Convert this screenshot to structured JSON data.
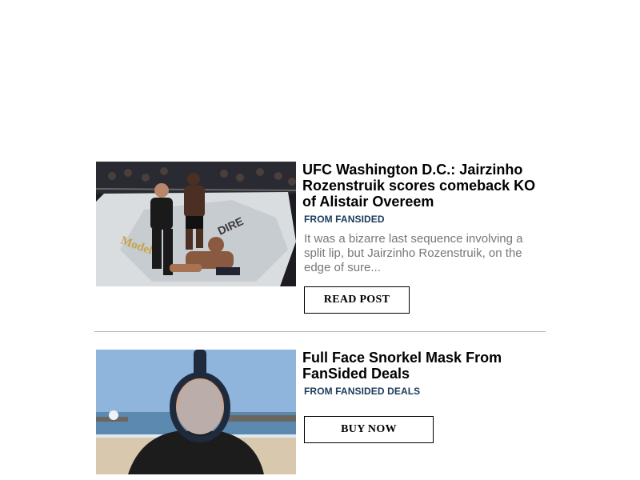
{
  "articles": [
    {
      "title": "UFC Washington D.C.: Jairzinho Rozenstruik scores comeback KO of Alistair Overeem",
      "source": "FROM FANSIDED",
      "excerpt": "It was a bizarre last sequence involving a split lip, but Jairzinho Rozenstruik, on the edge of sure...",
      "button_label": "READ POST",
      "image": {
        "octagon_text_1": "Modelo",
        "octagon_text_2": "DIRE"
      }
    },
    {
      "title": "Full Face Snorkel Mask From FanSided Deals",
      "source": "FROM FANSIDED DEALS",
      "button_label": "BUY NOW"
    }
  ],
  "colors": {
    "title": "#000000",
    "source": "#1b3a5b",
    "excerpt": "#777777",
    "divider": "#b5b5b5"
  }
}
